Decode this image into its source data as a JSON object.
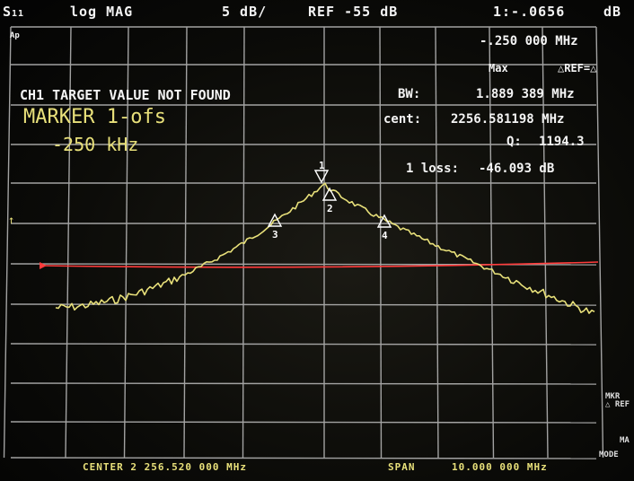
{
  "header": {
    "param": "S",
    "param_sub": "11",
    "format": "log MAG",
    "scale": "5 dB/",
    "ref": "REF -55 dB",
    "marker_readout": "1:-.0656",
    "marker_unit": "dB"
  },
  "annotations": {
    "ap": "Ap",
    "marker_freq": "-.250 000 MHz",
    "max_label": "Max",
    "delta_ref": "△REF=△",
    "message": "CH1 TARGET VALUE NOT FOUND",
    "marker_func_line1": "MARKER 1-ofs",
    "marker_func_line2": "-250 kHz",
    "bw_label": "BW:",
    "bw_value": "1.889 389 MHz",
    "cent_label": "cent:",
    "cent_value": "2256.581198 MHz",
    "q_label": "Q:",
    "q_value": "1194.3",
    "loss_label": "1 loss:",
    "loss_value": "-46.093 dB"
  },
  "markers": [
    {
      "id": "1"
    },
    {
      "id": "2"
    },
    {
      "id": "3"
    },
    {
      "id": "4"
    }
  ],
  "footer": {
    "center": "CENTER 2 256.520 000 MHz",
    "span": "SPAN",
    "span_value": "10.000 000 MHz"
  },
  "side": {
    "mkr_ref": "MKR\n△ REF",
    "mode": "MODE",
    "ma": "MA"
  },
  "colors": {
    "trace": "#e8e07a",
    "ref_line": "#ff3b3b",
    "grid": "#c9c9c9",
    "text": "#f4f4f4"
  }
}
